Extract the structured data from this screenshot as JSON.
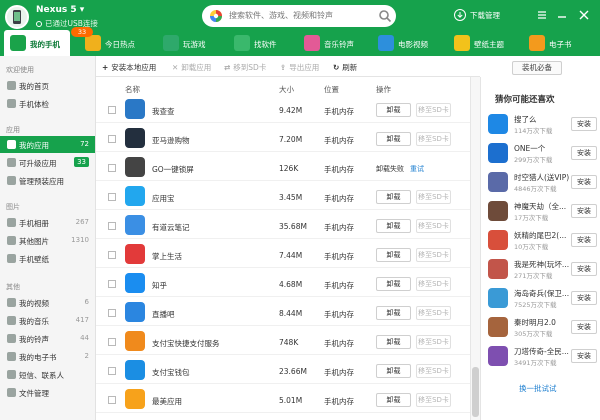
{
  "device": {
    "name": "Nexus 5 ▾",
    "status": "已通过USB连接"
  },
  "search": {
    "placeholder": "搜索软件、游戏、视频和铃声"
  },
  "download_manager": "下载管理",
  "nav": {
    "items": [
      {
        "label": "我的手机",
        "icon": "phone-icon",
        "color": "#1aa34a"
      },
      {
        "label": "今日热点",
        "icon": "hot-icon",
        "color": "#f0b01c"
      },
      {
        "label": "玩游戏",
        "icon": "game-icon",
        "color": "#2ea96b"
      },
      {
        "label": "找软件",
        "icon": "software-icon",
        "color": "#3ab86c"
      },
      {
        "label": "音乐铃声",
        "icon": "music-icon",
        "color": "#e35a96"
      },
      {
        "label": "电影视频",
        "icon": "video-icon",
        "color": "#2d8fdc"
      },
      {
        "label": "壁纸主题",
        "icon": "wallpaper-icon",
        "color": "#f2c21b"
      },
      {
        "label": "电子书",
        "icon": "ebook-icon",
        "color": "#f39a1d"
      }
    ],
    "new_badge": "33"
  },
  "sidebar": {
    "sections": [
      {
        "title": "欢迎使用",
        "items": [
          {
            "label": "我的首页",
            "count": ""
          },
          {
            "label": "手机体检",
            "count": ""
          }
        ]
      },
      {
        "title": "应用",
        "items": [
          {
            "label": "我的应用",
            "count": "72"
          },
          {
            "label": "可升级应用",
            "count": "33"
          },
          {
            "label": "管理预装应用",
            "count": ""
          }
        ]
      },
      {
        "title": "图片",
        "items": [
          {
            "label": "手机相册",
            "count": "267"
          },
          {
            "label": "其他图片",
            "count": "1310"
          },
          {
            "label": "手机壁纸",
            "count": ""
          }
        ]
      },
      {
        "title": "其他",
        "items": [
          {
            "label": "我的视频",
            "count": "6"
          },
          {
            "label": "我的音乐",
            "count": "417"
          },
          {
            "label": "我的铃声",
            "count": "44"
          },
          {
            "label": "我的电子书",
            "count": "2"
          },
          {
            "label": "短信、联系人",
            "count": ""
          },
          {
            "label": "文件管理",
            "count": ""
          }
        ]
      }
    ]
  },
  "toolbar": {
    "install_local": "安装本地应用",
    "uninstall": "卸载应用",
    "move_sd": "移到SD卡",
    "export": "导出应用",
    "refresh": "刷新",
    "essentials": "装机必备"
  },
  "table": {
    "headers": {
      "name": "名称",
      "size": "大小",
      "location": "位置",
      "action": "操作"
    },
    "rows": [
      {
        "name": "我查查",
        "size": "9.42M",
        "location": "手机内存",
        "btn1": "卸载",
        "btn2": "移至SD卡",
        "icon": "woshacha-icon",
        "color": "#2a78c6"
      },
      {
        "name": "亚马逊购物",
        "size": "7.20M",
        "location": "手机内存",
        "btn1": "卸载",
        "btn2": "移至SD卡",
        "icon": "amazon-icon",
        "color": "#232f3e"
      },
      {
        "name": "GO一键锁屏",
        "size": "126K",
        "location": "手机内存",
        "status": "卸载失败",
        "retry": "重试",
        "icon": "go-lock-icon",
        "color": "#444444"
      },
      {
        "name": "应用宝",
        "size": "3.45M",
        "location": "手机内存",
        "btn1": "卸载",
        "btn2": "移至SD卡",
        "icon": "yingyongbao-icon",
        "color": "#22a7ee"
      },
      {
        "name": "有道云笔记",
        "size": "35.68M",
        "location": "手机内存",
        "btn1": "卸载",
        "btn2": "移至SD卡",
        "icon": "youdao-note-icon",
        "color": "#3b8fe4"
      },
      {
        "name": "掌上生活",
        "size": "7.44M",
        "location": "手机内存",
        "btn1": "卸载",
        "btn2": "移至SD卡",
        "icon": "zhangshang-icon",
        "color": "#e23a3a"
      },
      {
        "name": "知乎",
        "size": "4.68M",
        "location": "手机内存",
        "btn1": "卸载",
        "btn2": "移至SD卡",
        "icon": "zhihu-icon",
        "color": "#1a8df0"
      },
      {
        "name": "直播吧",
        "size": "8.44M",
        "location": "手机内存",
        "btn1": "卸载",
        "btn2": "移至SD卡",
        "icon": "zhiboba-icon",
        "color": "#2b86e0"
      },
      {
        "name": "支付宝快捷支付服务",
        "size": "748K",
        "location": "手机内存",
        "btn1": "卸载",
        "btn2": "移至SD卡",
        "icon": "alipay-quick-icon",
        "color": "#f08a1c"
      },
      {
        "name": "支付宝钱包",
        "size": "23.66M",
        "location": "手机内存",
        "btn1": "卸载",
        "btn2": "移至SD卡",
        "icon": "alipay-wallet-icon",
        "color": "#1b8ee3"
      },
      {
        "name": "最美应用",
        "size": "5.01M",
        "location": "手机内存",
        "btn1": "卸载",
        "btn2": "移至SD卡",
        "icon": "zuimei-icon",
        "color": "#f7a21b"
      }
    ]
  },
  "recommend": {
    "title": "猜你可能还喜欢",
    "install_label": "安装",
    "refresh": "换一批试试",
    "items": [
      {
        "name": "搜了么",
        "downloads": "114万次下载",
        "icon": "soulme-icon",
        "color": "#1e88e5"
      },
      {
        "name": "ONE一个",
        "downloads": "299万次下载",
        "icon": "one-icon",
        "color": "#1c6fcf"
      },
      {
        "name": "时空猎人(送VIP)",
        "downloads": "4846万次下载",
        "icon": "shikong-icon",
        "color": "#5a6aa8"
      },
      {
        "name": "神魔天劫（全...",
        "downloads": "17万次下载",
        "icon": "shenmo-icon",
        "color": "#6e4b3a"
      },
      {
        "name": "妖精的尾巴2(...",
        "downloads": "10万次下载",
        "icon": "fairy-tail-icon",
        "color": "#d84f3b"
      },
      {
        "name": "我是死神(玩坏...",
        "downloads": "271万次下载",
        "icon": "bleach-icon",
        "color": "#c2554a"
      },
      {
        "name": "海岛奇兵(保卫...",
        "downloads": "7525万次下载",
        "icon": "boom-beach-icon",
        "color": "#3a9ad6"
      },
      {
        "name": "秦时明月2.0",
        "downloads": "305万次下载",
        "icon": "qinshi-icon",
        "color": "#a5643d"
      },
      {
        "name": "刀塔传奇-全民...",
        "downloads": "3491万次下载",
        "icon": "dota-icon",
        "color": "#7e4fb0"
      }
    ]
  }
}
